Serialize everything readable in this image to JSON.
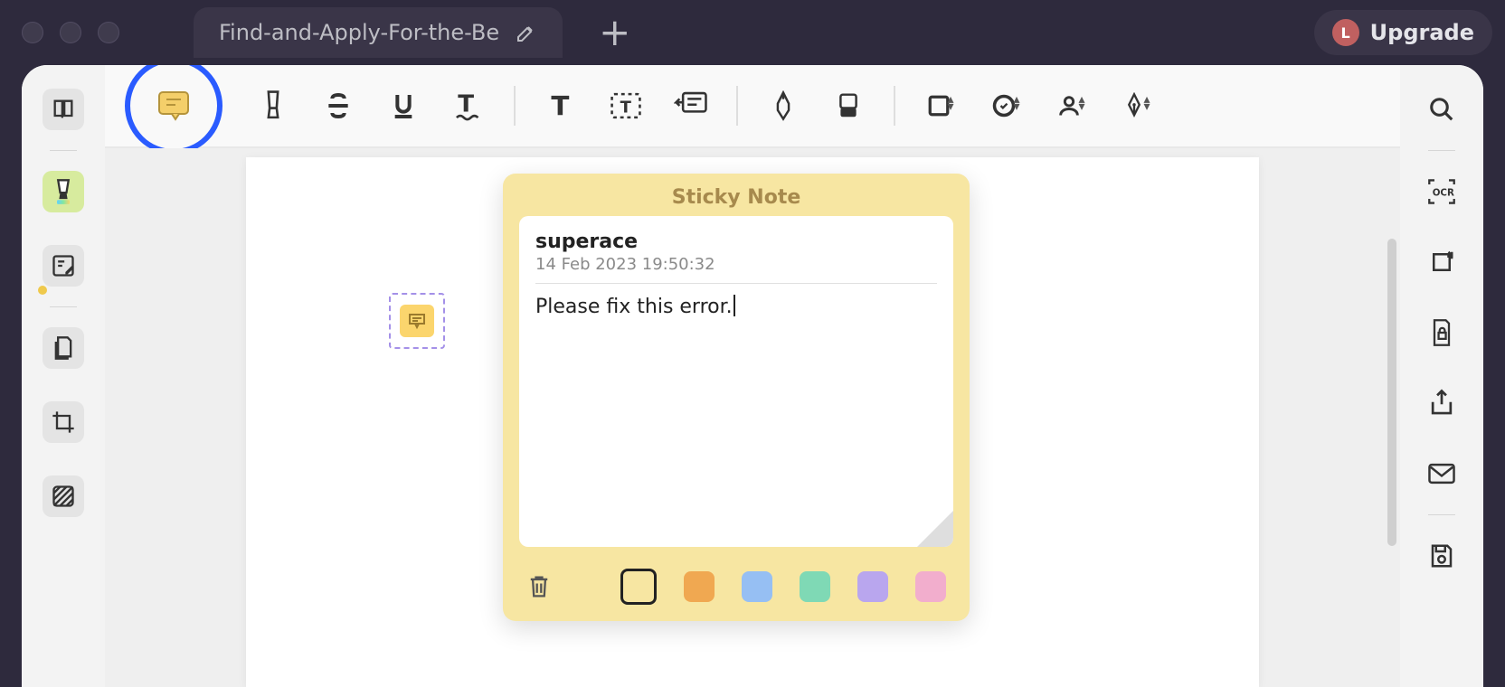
{
  "titlebar": {
    "tab_title": "Find-and-Apply-For-the-Be",
    "new_tab_glyph": "+",
    "upgrade_label": "Upgrade",
    "avatar_letter": "L"
  },
  "toolbar": {
    "active_tool": "comment-note"
  },
  "left_sidebar": {
    "items": [
      "thumbnails",
      "highlighter",
      "annotate",
      "page-list",
      "crop",
      "pattern"
    ]
  },
  "right_sidebar": {
    "items": [
      "search",
      "ocr",
      "rotate",
      "security",
      "share",
      "mail",
      "save"
    ]
  },
  "sticky_note": {
    "header": "Sticky Note",
    "author": "superace",
    "timestamp": "14 Feb 2023 19:50:32",
    "body": "Please fix this error.",
    "colors": {
      "outlined": "transparent",
      "orange": "#f0a851",
      "blue": "#96bff3",
      "teal": "#7fd9b5",
      "purple": "#b9a6ee",
      "pink": "#f2aecd"
    }
  }
}
